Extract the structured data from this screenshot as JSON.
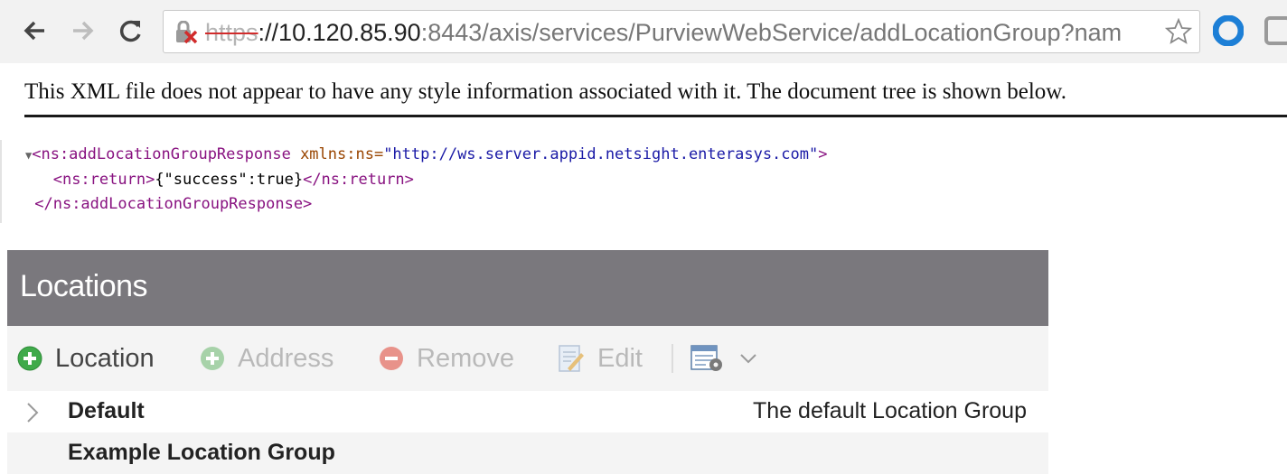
{
  "browser": {
    "url": {
      "scheme": "https",
      "host": "://10.120.85.90",
      "rest": ":8443/axis/services/PurviewWebService/addLocationGroup?nam"
    },
    "icons": {
      "back": "back-arrow-icon",
      "forward": "forward-arrow-icon",
      "reload": "reload-icon",
      "lock": "insecure-lock-icon",
      "bookmark": "star-icon",
      "ext1": "opera-icon",
      "ext2": "extension-icon"
    }
  },
  "xml_viewer": {
    "notice": "This XML file does not appear to have any style information associated with it. The document tree is shown below.",
    "tree": {
      "open_tag": "<ns:addLocationGroupResponse",
      "attr_name": "xmlns:ns=",
      "attr_value": "\"http://ws.server.appid.netsight.enterasys.com\"",
      "open_close": ">",
      "return_open": "<ns:return>",
      "return_text": "{\"success\":true}",
      "return_close": "</ns:return>",
      "close_tag": "</ns:addLocationGroupResponse>"
    }
  },
  "locations": {
    "title": "Locations",
    "toolbar": {
      "location_label": "Location",
      "address_label": "Address",
      "remove_label": "Remove",
      "edit_label": "Edit"
    },
    "rows": [
      {
        "name": "Default",
        "description": "The default Location Group"
      },
      {
        "name": "Example Location Group",
        "description": ""
      }
    ]
  },
  "colors": {
    "header_bg": "#7a787d",
    "add_green": "#3faa4a",
    "remove_red": "#e07a6e",
    "xml_tag": "#881280",
    "xml_attr": "#994500",
    "xml_value": "#1a1aa6"
  }
}
